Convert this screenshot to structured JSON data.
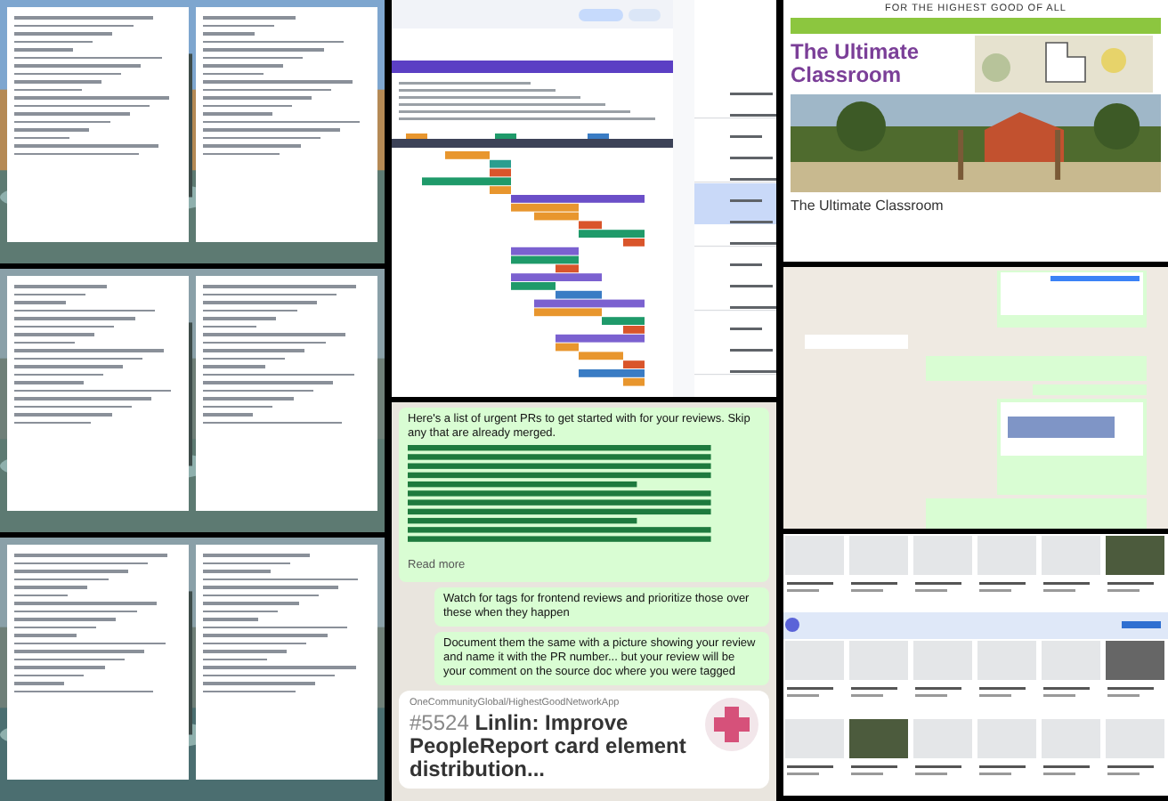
{
  "chat": {
    "intro": "Here's a list of urgent PRs to get started with for your reviews. Skip any that are already merged.",
    "read_more": "Read more",
    "messages": [
      "Watch for tags for frontend reviews and prioritize those over these when they happen",
      "Document them the same with a picture showing your review and name it with the PR number... but your review will be your comment on the source doc where you were tagged"
    ],
    "card": {
      "repo": "OneCommunityGlobal/HighestGoodNetworkApp",
      "number": "#5524",
      "title": "Linlin: Improve PeopleReport card element distribution..."
    }
  },
  "site": {
    "tagline": "FOR THE HIGHEST GOOD OF ALL",
    "hero_title": "The Ultimate Classroom",
    "heading": "The Ultimate Classroom"
  }
}
